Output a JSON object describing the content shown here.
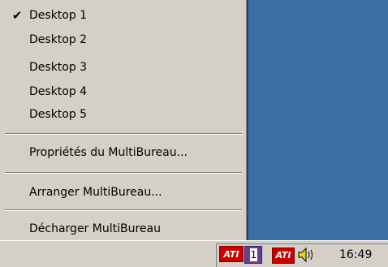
{
  "menu": {
    "items": [
      {
        "label": "Desktop 1",
        "checked": true
      },
      {
        "label": "Desktop 2",
        "checked": false
      },
      {
        "label": "Desktop 3",
        "checked": false
      },
      {
        "label": "Desktop 4",
        "checked": false
      },
      {
        "label": "Desktop 5",
        "checked": false
      }
    ],
    "check_glyph": "✔",
    "properties_label": "Propriétés du MultiBureau...",
    "arrange_label": "Arranger MultiBureau...",
    "unload_label": "Décharger MultiBureau"
  },
  "tray": {
    "ati_logo_text": "ATI",
    "desktop_number": "1",
    "clock": "16:49"
  },
  "colors": {
    "desktop_background": "#3a6ea5",
    "menu_background": "#d4d0c8",
    "ati_red": "#cc0000",
    "desktop_indicator_purple": "#6a3d9a"
  }
}
